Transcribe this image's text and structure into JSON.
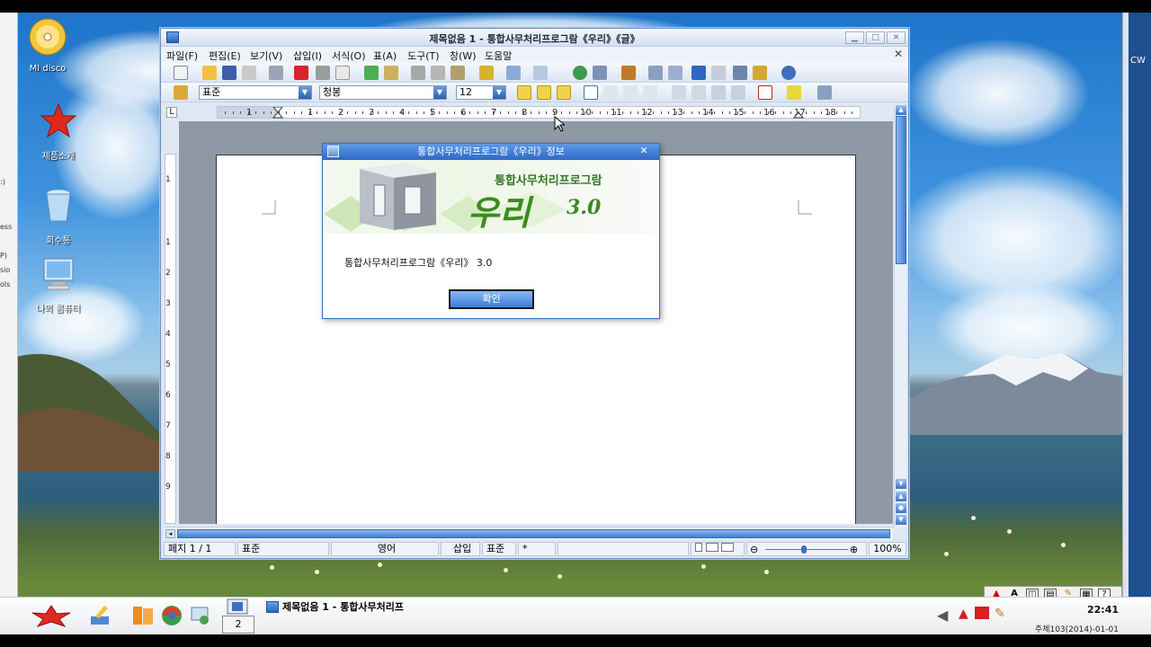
{
  "desktop": {
    "icons": [
      {
        "label": "MI disco"
      },
      {
        "label": "제품소개"
      },
      {
        "label": "회수통"
      },
      {
        "label": "나의 콤퓨터"
      }
    ],
    "left_strip_fragments": [
      ":)",
      "ess",
      "P)",
      "sio",
      "ols"
    ],
    "right_strip_label": "CW"
  },
  "window": {
    "title": "제목없음 1 - 통합사무처리프로그람《우리》《글》",
    "menu": [
      "파일(F)",
      "편집(E)",
      "보기(V)",
      "삽입(I)",
      "서식(O)",
      "표(A)",
      "도구(T)",
      "창(W)",
      "도움말"
    ],
    "format": {
      "style": "표준",
      "font": "청봉",
      "size": "12"
    },
    "ruler_numbers": [
      "1",
      "1",
      "2",
      "3",
      "4",
      "5",
      "6",
      "7",
      "8",
      "9",
      "10",
      "11",
      "12",
      "13",
      "14",
      "15",
      "16",
      "17",
      "18"
    ],
    "vruler_numbers": [
      "1",
      "1",
      "2",
      "3",
      "4",
      "5",
      "6",
      "7",
      "8",
      "9"
    ],
    "status": {
      "page": "페지  1 / 1",
      "style": "표준",
      "lang": "영어",
      "mode": "삽입",
      "std": "표준",
      "star": "*",
      "zoom": "100%"
    }
  },
  "dialog": {
    "title": "통합사무처리프로그람《우리》정보",
    "banner_top": "통합사무처리프로그람",
    "banner_logo": "우리",
    "banner_version": "3.0",
    "info": "통합사무처리프로그람《우리》 3.0",
    "ok_label": "확인"
  },
  "taskbar": {
    "task_label": "제목없음 1 - 통합사무처리프",
    "pager": "2",
    "clock": "22:41",
    "date": "주체103(2014)-01-01"
  }
}
